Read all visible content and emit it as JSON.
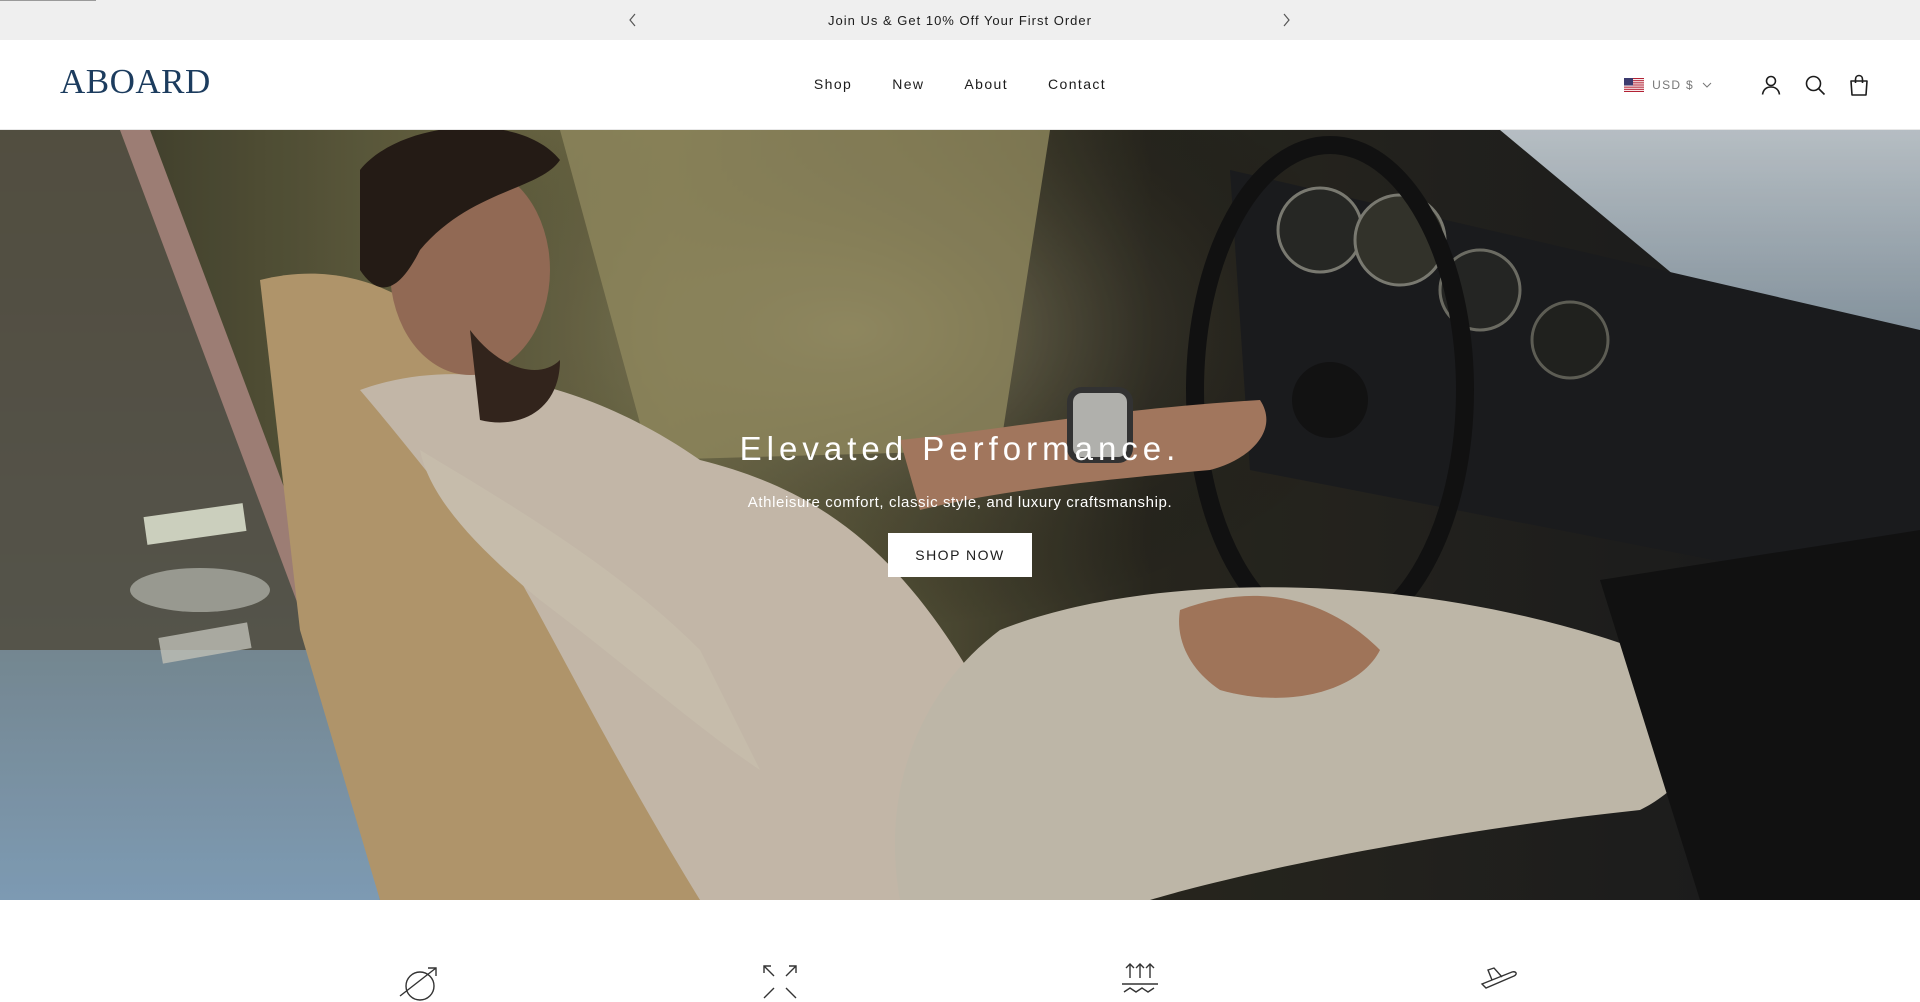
{
  "announcement": {
    "message": "Join Us & Get 10% Off Your First Order",
    "prev_icon": "chevron-left-icon",
    "next_icon": "chevron-right-icon"
  },
  "header": {
    "logo": "ABOARD",
    "nav": [
      "Shop",
      "New",
      "About",
      "Contact"
    ],
    "currency": {
      "code": "USD $",
      "flag_icon": "us-flag-icon",
      "dropdown_icon": "chevron-down-icon"
    },
    "icons": [
      "account-icon",
      "search-icon",
      "bag-icon"
    ]
  },
  "hero": {
    "title": "Elevated Performance.",
    "subtitle": "Athleisure comfort, classic style, and luxury craftsmanship.",
    "button": "SHOP NOW"
  },
  "features": {
    "icons": [
      "no-wrinkle-icon",
      "stretch-icon",
      "breathable-icon",
      "travel-icon"
    ]
  },
  "colors": {
    "announcement_bg": "#efefef",
    "logo": "#1c3c5e",
    "text": "#1c1c1c",
    "hero_button_bg": "#ffffff"
  }
}
